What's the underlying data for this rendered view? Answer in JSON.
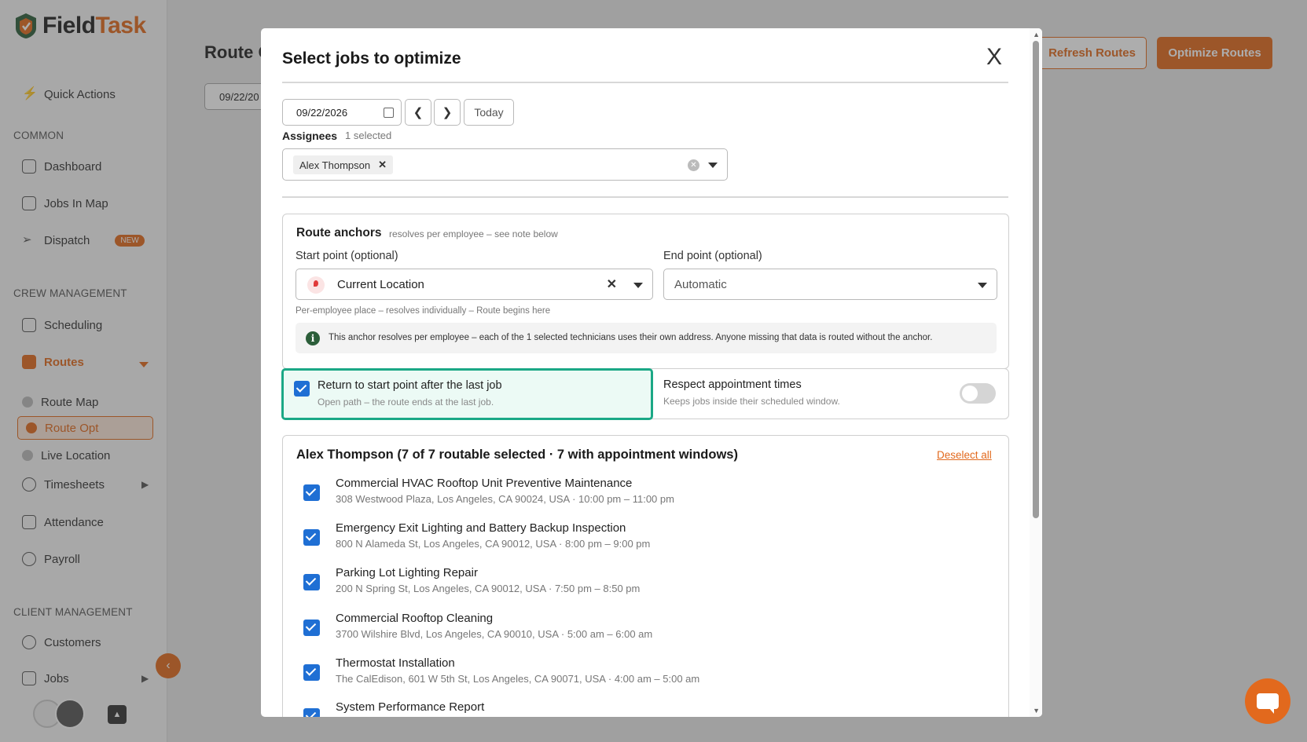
{
  "app": {
    "brand_part1": "Field",
    "brand_part2": "Task"
  },
  "sidebar": {
    "quick_actions": "Quick Actions",
    "sections": {
      "common": "COMMON",
      "crew": "CREW MANAGEMENT",
      "client": "CLIENT MANAGEMENT"
    },
    "items": {
      "dashboard": "Dashboard",
      "jobs_in_map": "Jobs In Map",
      "dispatch": "Dispatch",
      "dispatch_badge": "NEW",
      "scheduling": "Scheduling",
      "routes": "Routes",
      "route_map": "Route Map",
      "route_opt": "Route Opt",
      "live_location": "Live Location",
      "timesheets": "Timesheets",
      "attendance": "Attendance",
      "payroll": "Payroll",
      "customers": "Customers",
      "jobs": "Jobs"
    }
  },
  "page": {
    "title": "Route O",
    "date": "09/22/20",
    "refresh_label": "Refresh Routes",
    "optimize_label": "Optimize Routes"
  },
  "modal": {
    "title": "Select jobs to optimize",
    "close": "X",
    "date": "09/22/2026",
    "today_label": "Today",
    "assignees_label": "Assignees",
    "assignees_count": "1 selected",
    "assignee_chip": "Alex Thompson",
    "anchors": {
      "title": "Route anchors",
      "subtitle": "resolves per employee – see note below",
      "start_label": "Start point (optional)",
      "start_value": "Current Location",
      "end_label": "End point (optional)",
      "end_value": "Automatic",
      "hint": "Per-employee place – resolves individually – Route begins here",
      "info": "This anchor resolves per employee – each of the 1 selected technicians uses their own address. Anyone missing that data is routed without the anchor."
    },
    "options": {
      "return_title": "Return to start point after the last job",
      "return_sub": "Open path – the route ends at the last job.",
      "return_checked": true,
      "respect_title": "Respect appointment times",
      "respect_sub": "Keeps jobs inside their scheduled window.",
      "respect_on": false
    },
    "jobs": {
      "header": "Alex Thompson (7 of 7 routable selected · 7 with appointment windows)",
      "deselect_label": "Deselect all",
      "items": [
        {
          "name": "Commercial HVAC Rooftop Unit Preventive Maintenance",
          "addr": "308 Westwood Plaza, Los Angeles, CA 90024, USA · 10:00 pm – 11:00 pm",
          "checked": true
        },
        {
          "name": "Emergency Exit Lighting and Battery Backup Inspection",
          "addr": "800 N Alameda St, Los Angeles, CA 90012, USA · 8:00 pm – 9:00 pm",
          "checked": true
        },
        {
          "name": "Parking Lot Lighting Repair",
          "addr": "200 N Spring St, Los Angeles, CA 90012, USA · 7:50 pm – 8:50 pm",
          "checked": true
        },
        {
          "name": "Commercial Rooftop Cleaning",
          "addr": "3700 Wilshire Blvd, Los Angeles, CA 90010, USA · 5:00 am – 6:00 am",
          "checked": true
        },
        {
          "name": "Thermostat Installation",
          "addr": "The CalEdison, 601 W 5th St, Los Angeles, CA 90071, USA · 4:00 am – 5:00 am",
          "checked": true
        },
        {
          "name": "System Performance Report",
          "addr": "",
          "checked": true
        }
      ]
    }
  },
  "colors": {
    "brand": "#e2691d",
    "check": "#1f6fd4",
    "highlight": "#1ba886"
  }
}
